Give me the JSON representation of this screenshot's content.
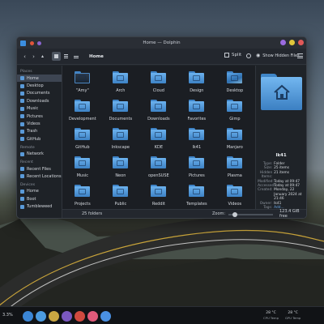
{
  "window": {
    "title": "Home — Dolphin",
    "title_dot_colors": [
      "#3b8ee0",
      "#e0553b",
      "#8a64d0"
    ],
    "control_colors": [
      "#9b6be0",
      "#e0c63b",
      "#e05858"
    ]
  },
  "toolbar": {
    "back_icon": "chevron-left-icon",
    "forward_icon": "chevron-right-icon",
    "up_icon": "arrow-up-icon",
    "breadcrumb": "Home",
    "split_label": "Split",
    "hidden_files_label": "Show Hidden Files"
  },
  "sidebar": {
    "sections": [
      {
        "title": "Places",
        "items": [
          "Home",
          "Desktop",
          "Documents",
          "Downloads",
          "Music",
          "Pictures",
          "Videos",
          "Trash",
          "GitHub"
        ]
      },
      {
        "title": "Remote",
        "items": [
          "Network"
        ]
      },
      {
        "title": "Recent",
        "items": [
          "Recent Files",
          "Recent Locations"
        ]
      },
      {
        "title": "Devices",
        "items": [
          "Home",
          "Boot",
          "Tumbleweed"
        ]
      }
    ],
    "active_item": "Home"
  },
  "files": [
    {
      "name": "\"Amy\"",
      "style": "home-img"
    },
    {
      "name": "Arch",
      "style": "plain"
    },
    {
      "name": "Cloud",
      "style": "plain"
    },
    {
      "name": "Design",
      "style": "plain"
    },
    {
      "name": "Desktop",
      "style": "desktop-img"
    },
    {
      "name": "Development",
      "style": "plain"
    },
    {
      "name": "Documents",
      "style": "plain"
    },
    {
      "name": "Downloads",
      "style": "plain"
    },
    {
      "name": "Favorites",
      "style": "plain"
    },
    {
      "name": "Gimp",
      "style": "plain"
    },
    {
      "name": "GitHub",
      "style": "plain"
    },
    {
      "name": "Inkscape",
      "style": "plain"
    },
    {
      "name": "KDE",
      "style": "plain"
    },
    {
      "name": "lk41",
      "style": "plain"
    },
    {
      "name": "Manjaro",
      "style": "plain"
    },
    {
      "name": "Music",
      "style": "plain"
    },
    {
      "name": "Neon",
      "style": "plain"
    },
    {
      "name": "openSUSE",
      "style": "plain"
    },
    {
      "name": "Pictures",
      "style": "plain"
    },
    {
      "name": "Plasma",
      "style": "plain"
    },
    {
      "name": "Projects",
      "style": "plain"
    },
    {
      "name": "Public",
      "style": "plain"
    },
    {
      "name": "Reddit",
      "style": "plain"
    },
    {
      "name": "Templates",
      "style": "plain"
    },
    {
      "name": "Videos",
      "style": "plain"
    }
  ],
  "info_panel": {
    "name": "lk41",
    "properties": [
      {
        "key": "Type:",
        "value": "Folder"
      },
      {
        "key": "Size:",
        "value": "25 items"
      },
      {
        "key": "Hidden Items:",
        "value": "21 items"
      },
      {
        "key": "Modified:",
        "value": "Today at 09:47"
      },
      {
        "key": "Accessed:",
        "value": "Today at 09:47"
      },
      {
        "key": "Created:",
        "value": "Monday, 22 January 2024 at 21:46"
      },
      {
        "key": "Owner:",
        "value": "lk41"
      },
      {
        "key": "Tags:",
        "value": "Add...",
        "link": true
      },
      {
        "key": "Rating:",
        "value": "★★★★★",
        "stars": true
      },
      {
        "key": "Comment:",
        "value": "Add...",
        "link": true
      }
    ]
  },
  "status": {
    "count": "25 folders",
    "zoom_label": "Zoom:",
    "zoom_level": 0.1,
    "free_space": "123.4 GiB free"
  },
  "taskbar": {
    "left_label": "3.3%",
    "app_colors": [
      "#3b86d6",
      "#4c9be0",
      "#c9a642",
      "#7a58c0",
      "#d04a3f",
      "#e05a7a",
      "#4a90e2"
    ],
    "cpu_temp": "28 °C",
    "cpu_label": "CPU Temp",
    "gpu_temp": "28 °C",
    "gpu_label": "GPU Temp"
  }
}
